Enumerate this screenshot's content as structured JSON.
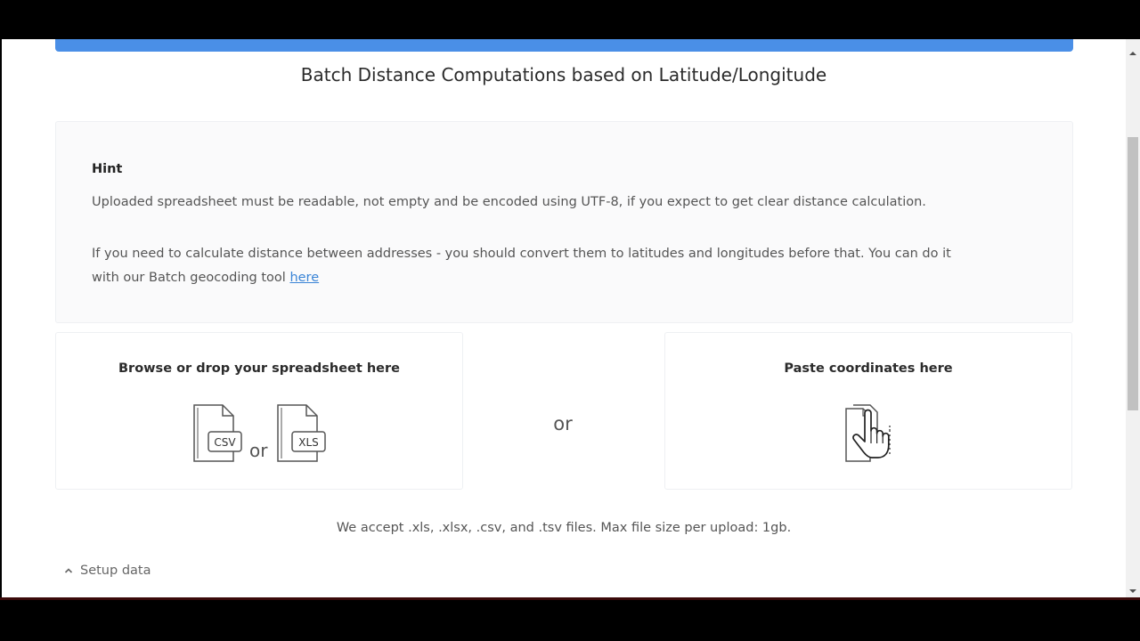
{
  "page": {
    "title": "Batch Distance Computations based on Latitude/Longitude"
  },
  "hint": {
    "title": "Hint",
    "paragraph1": "Uploaded spreadsheet must be readable, not empty and be encoded using UTF-8, if you expect to get clear distance calculation.",
    "paragraph2": "If you need to calculate distance between addresses - you should convert them to latitudes and longitudes before that. You can do it with our Batch geocoding tool ",
    "link_label": "here"
  },
  "upload": {
    "browse_title": "Browse or drop your spreadsheet here",
    "csv_label": "CSV",
    "xls_label": "XLS",
    "or_small": "or",
    "or_middle": "or",
    "paste_title": "Paste coordinates here",
    "accept_text": "We accept .xls, .xlsx, .csv, and .tsv files. Max file size per upload: 1gb."
  },
  "setup": {
    "label": "Setup data",
    "icon": "chevron-up-icon"
  },
  "colors": {
    "accent": "#4a8fe7",
    "link": "#3a84d6"
  }
}
